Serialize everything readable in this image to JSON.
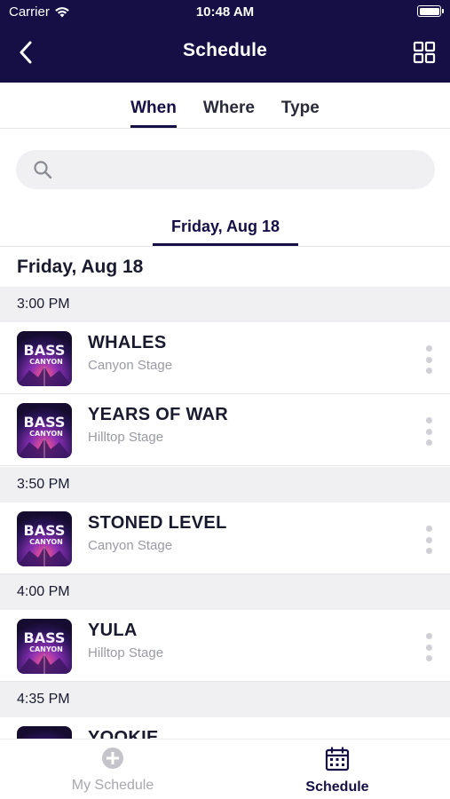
{
  "status_bar": {
    "carrier": "Carrier",
    "time": "10:48 AM"
  },
  "header": {
    "title": "Schedule",
    "back_icon": "chevron-left-icon",
    "grid_icon": "grid-view-icon"
  },
  "filter_tabs": [
    {
      "label": "When",
      "active": true
    },
    {
      "label": "Where",
      "active": false
    },
    {
      "label": "Type",
      "active": false
    }
  ],
  "search": {
    "placeholder": ""
  },
  "date_tab": {
    "label": "Friday, Aug 18"
  },
  "day_heading": "Friday, Aug 18",
  "time_groups": [
    {
      "time": "3:00 PM",
      "events": [
        {
          "name": "WHALES",
          "stage": "Canyon Stage"
        },
        {
          "name": "YEARS OF WAR",
          "stage": "Hilltop Stage"
        }
      ]
    },
    {
      "time": "3:50 PM",
      "events": [
        {
          "name": "STONED LEVEL",
          "stage": "Canyon Stage"
        }
      ]
    },
    {
      "time": "4:00 PM",
      "events": [
        {
          "name": "YULA",
          "stage": "Hilltop Stage"
        }
      ]
    },
    {
      "time": "4:35 PM",
      "events": [
        {
          "name": "YOOKIE",
          "stage": ""
        }
      ]
    }
  ],
  "event_logo_text": [
    "BASS",
    "CANYON"
  ],
  "tab_bar": {
    "my_schedule": "My Schedule",
    "schedule": "Schedule"
  },
  "colors": {
    "brand": "#150f45",
    "muted": "#9a9aa4",
    "section_bg": "#f0f0f3"
  }
}
